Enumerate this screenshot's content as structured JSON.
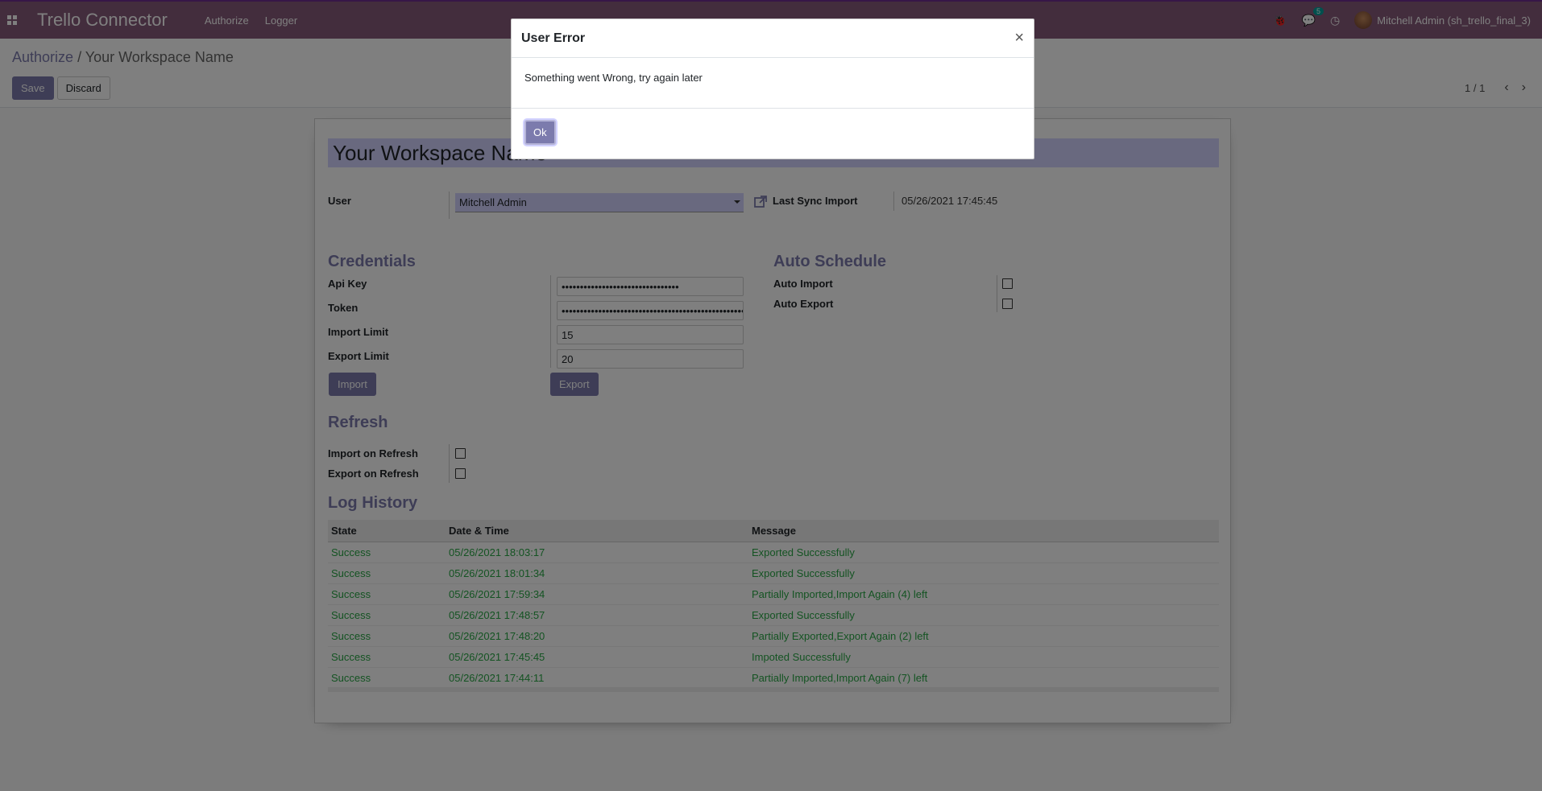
{
  "navbar": {
    "brand": "Trello Connector",
    "menu": [
      "Authorize",
      "Logger"
    ],
    "message_count": "5",
    "user_name": "Mitchell Admin (sh_trello_final_3)"
  },
  "control_panel": {
    "breadcrumb_parent": "Authorize",
    "breadcrumb_separator": "/",
    "breadcrumb_current": "Your Workspace Name",
    "save_label": "Save",
    "discard_label": "Discard",
    "pager": "1 / 1"
  },
  "form": {
    "name": "Your Workspace Name",
    "user_label": "User",
    "user_value": "Mitchell Admin",
    "last_sync_label": "Last Sync Import",
    "last_sync_value": "05/26/2021 17:45:45",
    "credentials_title": "Credentials",
    "api_key_label": "Api Key",
    "api_key_value": "••••••••••••••••••••••••••••••••",
    "token_label": "Token",
    "token_value": "••••••••••••••••••••••••••••••••••••••••••••••••••••",
    "import_limit_label": "Import Limit",
    "import_limit_value": "15",
    "export_limit_label": "Export Limit",
    "export_limit_value": "20",
    "import_button": "Import",
    "export_button": "Export",
    "auto_schedule_title": "Auto Schedule",
    "auto_import_label": "Auto Import",
    "auto_export_label": "Auto Export",
    "refresh_title": "Refresh",
    "import_on_refresh_label": "Import on Refresh",
    "export_on_refresh_label": "Export on Refresh",
    "log_history_title": "Log History"
  },
  "log_table": {
    "headers": [
      "State",
      "Date & Time",
      "Message"
    ],
    "rows": [
      [
        "Success",
        "05/26/2021 18:03:17",
        "Exported Successfully"
      ],
      [
        "Success",
        "05/26/2021 18:01:34",
        "Exported Successfully"
      ],
      [
        "Success",
        "05/26/2021 17:59:34",
        "Partially Imported,Import Again (4) left"
      ],
      [
        "Success",
        "05/26/2021 17:48:57",
        "Exported Successfully"
      ],
      [
        "Success",
        "05/26/2021 17:48:20",
        "Partially Exported,Export Again (2) left"
      ],
      [
        "Success",
        "05/26/2021 17:45:45",
        "Impoted Successfully"
      ],
      [
        "Success",
        "05/26/2021 17:44:11",
        "Partially Imported,Import Again (7) left"
      ]
    ]
  },
  "modal": {
    "title": "User Error",
    "close": "×",
    "message": "Something went Wrong, try again later",
    "ok_label": "Ok"
  },
  "colors": {
    "navbar": "#875a7b",
    "accent": "#7c7bad",
    "success": "#28a745"
  }
}
